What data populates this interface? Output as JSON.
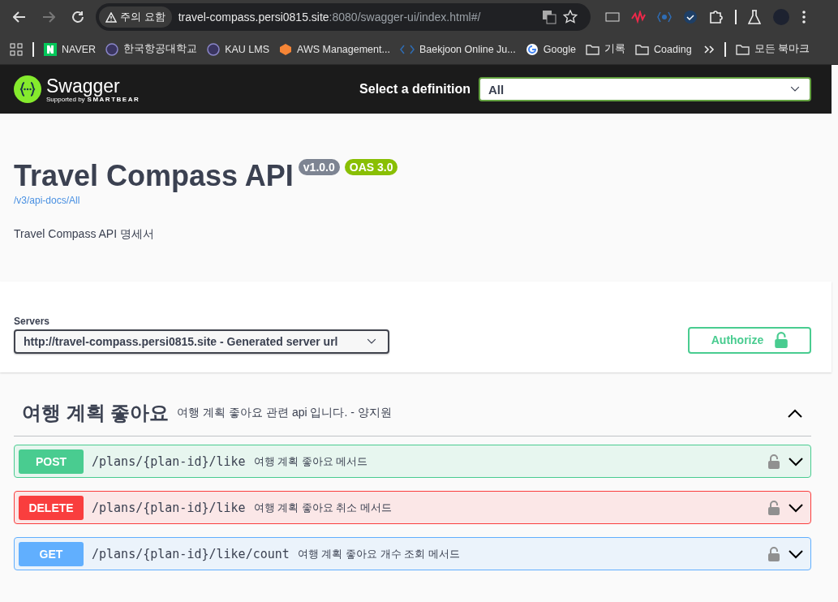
{
  "browser": {
    "security_chip": "주의 요함",
    "url_host": "travel-compass.persi0815.site",
    "url_rest": ":8080/swagger-ui/index.html#/"
  },
  "bookmarks": [
    {
      "label": "NAVER",
      "kind": "naver"
    },
    {
      "label": "한국항공대학교",
      "kind": "globe"
    },
    {
      "label": "KAU LMS",
      "kind": "globe"
    },
    {
      "label": "AWS Management...",
      "kind": "aws"
    },
    {
      "label": "Baekjoon Online Ju...",
      "kind": "code"
    },
    {
      "label": "Google",
      "kind": "google"
    },
    {
      "label": "기록",
      "kind": "folder"
    },
    {
      "label": "Coading",
      "kind": "folder"
    }
  ],
  "all_bookmarks": "모든 북마크",
  "swagger": {
    "logo": "Swagger",
    "supported_by": "Supported by",
    "smartbear": "SMARTBEAR",
    "definition_label": "Select a definition",
    "definition_value": "All"
  },
  "info": {
    "title": "Travel Compass API",
    "version": "v1.0.0",
    "oas": "OAS 3.0",
    "link": "/v3/api-docs/All",
    "description": "Travel Compass API 명세서"
  },
  "servers": {
    "label": "Servers",
    "value": "http://travel-compass.persi0815.site - Generated server url",
    "authorize": "Authorize"
  },
  "tag": {
    "name": "여행 계획 좋아요",
    "description": "여행 계획 좋아요 관련 api 입니다. - 양지원",
    "expanded": true
  },
  "operations": [
    {
      "method": "POST",
      "kind": "post",
      "path": "/plans/{plan-id}/like",
      "summary": "여행 계획 좋아요 메서드",
      "expanded": false
    },
    {
      "method": "DELETE",
      "kind": "delete",
      "path": "/plans/{plan-id}/like",
      "summary": "여행 계획 좋아요 취소 메서드",
      "expanded": false
    },
    {
      "method": "GET",
      "kind": "get",
      "path": "/plans/{plan-id}/like/count",
      "summary": "여행 계획 좋아요 개수 조회 메서드",
      "expanded": false
    }
  ]
}
